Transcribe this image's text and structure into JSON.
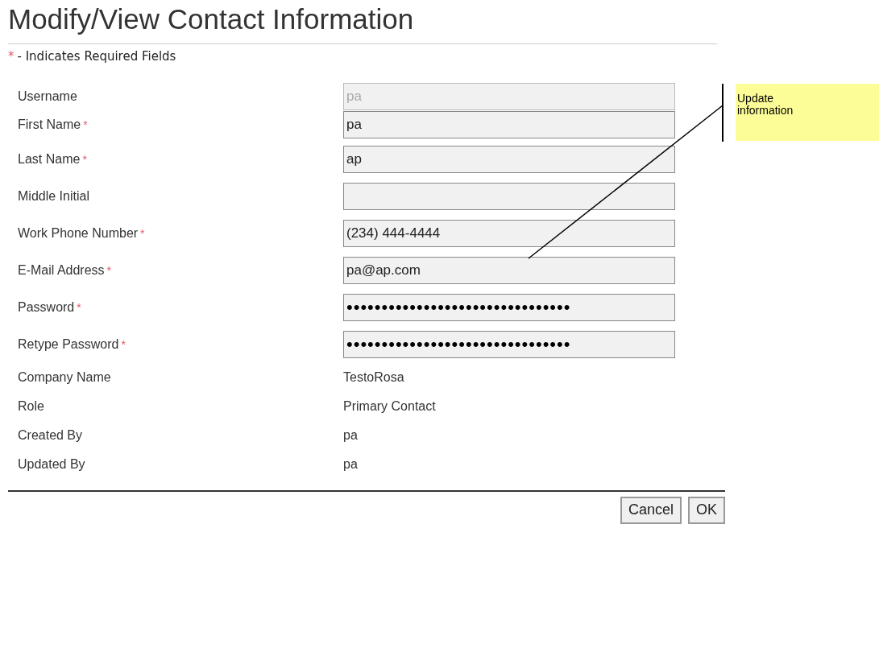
{
  "title": "Modify/View Contact Information",
  "required_note": {
    "mark": "*",
    "text": "- Indicates Required Fields"
  },
  "fields": [
    {
      "kind": "input",
      "label": "Username",
      "value": "pa",
      "disabled": true
    },
    {
      "kind": "input",
      "label": "First Name",
      "required_mark": "*",
      "value": "pa",
      "disabled": false
    },
    {
      "kind": "input",
      "label": "Last Name",
      "required_mark": "*",
      "value": "ap",
      "disabled": false
    },
    {
      "kind": "input",
      "label": "Middle Initial",
      "disabled": false
    },
    {
      "kind": "input",
      "label": "Work Phone Number",
      "required_mark": "*",
      "value": "(234) 444-4444",
      "disabled": false
    },
    {
      "kind": "input",
      "label": "E-Mail Address",
      "required_mark": "*",
      "value": "pa@ap.com",
      "disabled": false
    },
    {
      "kind": "password",
      "label": "Password",
      "required_mark": "*",
      "value": "••••••••••••••••••••••••••••••••",
      "disabled": false
    },
    {
      "kind": "password",
      "label": "Retype Password",
      "required_mark": "*",
      "value": "••••••••••••••••••••••••••••••••",
      "disabled": false
    },
    {
      "kind": "text",
      "label": "Company Name",
      "value": "TestoRosa"
    },
    {
      "kind": "text",
      "label": "Role",
      "value": "Primary Contact"
    },
    {
      "kind": "text",
      "label": "Created By",
      "value": "pa"
    },
    {
      "kind": "text",
      "label": "Updated By",
      "value": "pa"
    }
  ],
  "buttons": [
    "Cancel",
    "OK"
  ],
  "callout": {
    "text": "Update information"
  }
}
